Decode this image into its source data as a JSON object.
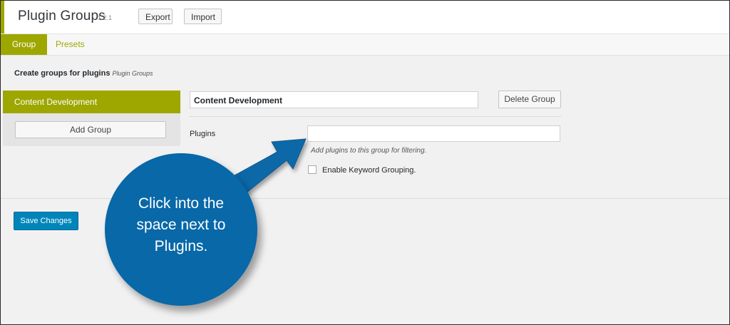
{
  "header": {
    "title": "Plugin Groups",
    "version": "1.2.1",
    "export_label": "Export",
    "import_label": "Import"
  },
  "tabs": [
    {
      "label": "Group",
      "active": true
    },
    {
      "label": "Presets",
      "active": false
    }
  ],
  "description": {
    "text": "Create groups for plugins",
    "subtext": "Plugin Groups"
  },
  "sidebar": {
    "active_group": "Content Development",
    "add_group_label": "Add Group"
  },
  "group": {
    "name_value": "Content Development",
    "delete_label": "Delete Group",
    "plugins_label": "Plugins",
    "plugins_value": "",
    "plugins_hint": "Add plugins to this group for filtering.",
    "keyword_label": "Enable Keyword Grouping.",
    "keyword_checked": false
  },
  "footer": {
    "save_label": "Save Changes"
  },
  "callout": {
    "text_line1": "Click into the",
    "text_line2": "space next to",
    "text_line3": "Plugins."
  },
  "colors": {
    "accent": "#9ea700",
    "primary_button": "#0085ba",
    "callout": "#0868a8"
  }
}
